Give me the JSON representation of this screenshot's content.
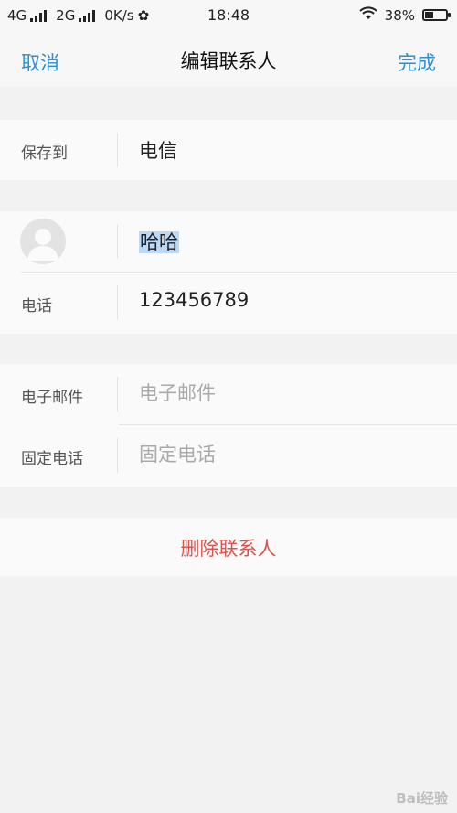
{
  "status_bar": {
    "network1": "4G",
    "network2": "2G",
    "speed": "0K/s",
    "time": "18:48",
    "battery_percent_text": "38%",
    "battery_level": 0.38,
    "icons": [
      "signal-icon",
      "settings-icon",
      "wifi-icon",
      "battery-icon"
    ]
  },
  "nav": {
    "cancel": "取消",
    "title": "编辑联系人",
    "done": "完成"
  },
  "save_to": {
    "label": "保存到",
    "value": "电信"
  },
  "contact": {
    "name": "哈哈",
    "phone_label": "电话",
    "phone": "123456789"
  },
  "extra": {
    "email_label": "电子邮件",
    "email_placeholder": "电子邮件",
    "landline_label": "固定电话",
    "landline_placeholder": "固定电话"
  },
  "actions": {
    "delete": "删除联系人"
  },
  "colors": {
    "accent": "#2b8fd6",
    "danger": "#d9534f",
    "selection": "#bcd9f7"
  },
  "watermark": "Bai经验"
}
